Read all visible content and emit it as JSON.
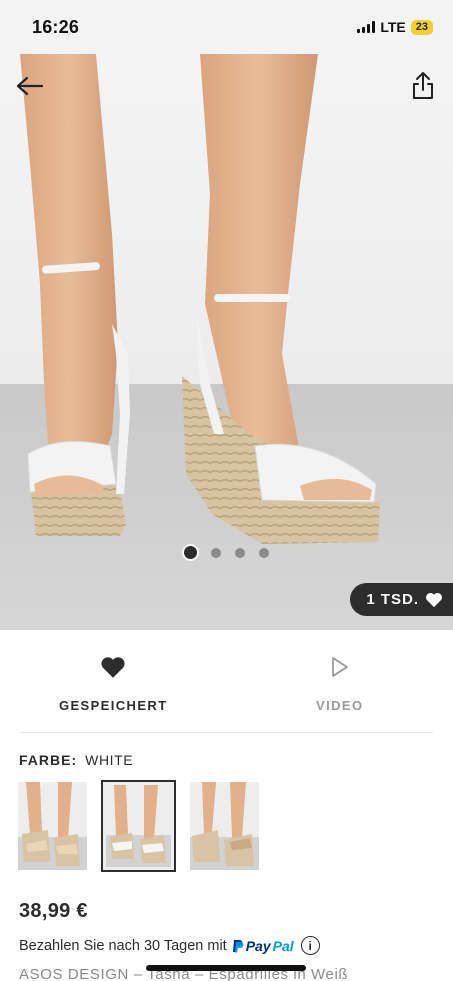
{
  "status_bar": {
    "time": "16:26",
    "network": "LTE",
    "battery": "23"
  },
  "gallery": {
    "image_count": 4,
    "active_index": 0,
    "saved_count_label": "1 TSD."
  },
  "actions": {
    "saved_label": "GESPEICHERT",
    "video_label": "VIDEO"
  },
  "colour": {
    "label": "FARBE:",
    "value": "WHITE"
  },
  "price": "38,99 €",
  "paypal": {
    "text": "Bezahlen Sie nach 30 Tagen mit",
    "brand_a": "Pay",
    "brand_b": "Pal",
    "info": "i"
  },
  "product_title": "ASOS DESIGN – Tasha – Espadrilles in Weiß",
  "colors": {
    "text": "#2d2d2d",
    "battery": "#f5d02b",
    "paypal_dark": "#003087",
    "paypal_light": "#009cde"
  }
}
